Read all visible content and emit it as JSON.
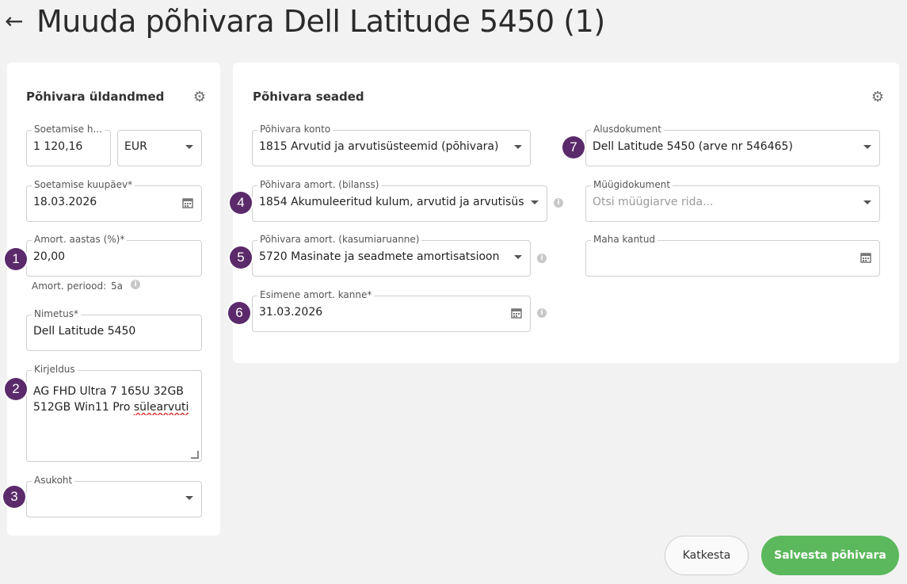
{
  "header": {
    "back_icon": "arrow-left-icon",
    "title": "Muuda põhivara Dell Latitude 5450 (1)"
  },
  "general": {
    "title": "Põhivara üldandmed",
    "acquisition_cost": {
      "label": "Soetamise h...",
      "value": "1 120,16"
    },
    "currency": {
      "value": "EUR"
    },
    "acquisition_date": {
      "label": "Soetamise kuupäev*",
      "value": "18.03.2026"
    },
    "depreciation_rate": {
      "label": "Amort. aastas (%)*",
      "value": "20,00"
    },
    "depreciation_period": {
      "label": "Amort. periood:",
      "value": "5a"
    },
    "name": {
      "label": "Nimetus*",
      "value": "Dell Latitude 5450"
    },
    "description": {
      "label": "Kirjeldus",
      "line1": "AG FHD Ultra 7 165U 32GB",
      "line2_a": "512GB Win11 Pro ",
      "line2_b": "sülearvuti"
    },
    "location": {
      "label": "Asukoht",
      "value": ""
    }
  },
  "settings": {
    "title": "Põhivara seaded",
    "asset_account": {
      "label": "Põhivara konto",
      "value": "1815 Arvutid ja arvutisüsteemid (põhivara)"
    },
    "depr_balance": {
      "label": "Põhivara amort. (bilanss)",
      "value": "1854 Akumuleeritud kulum, arvutid ja arvutisüst..."
    },
    "depr_income": {
      "label": "Põhivara amort. (kasumiaruanne)",
      "value": "5720 Masinate ja seadmete amortisatsioon"
    },
    "first_entry": {
      "label": "Esimene amort. kanne*",
      "value": "31.03.2026"
    },
    "base_document": {
      "label": "Alusdokument",
      "value": "Dell Latitude 5450 (arve nr 546465)"
    },
    "sales_document": {
      "label": "Müügidokument",
      "placeholder": "Otsi müügiarve rida..."
    },
    "written_off": {
      "label": "Maha kantud",
      "value": ""
    }
  },
  "badges": [
    "1",
    "2",
    "3",
    "4",
    "5",
    "6",
    "7"
  ],
  "actions": {
    "cancel": "Katkesta",
    "save": "Salvesta põhivara"
  },
  "colors": {
    "accent": "#5cb85c",
    "badge": "#5a2a6a"
  }
}
